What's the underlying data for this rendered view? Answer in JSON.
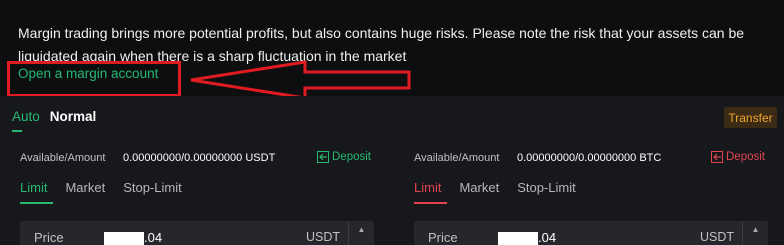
{
  "banner": {
    "message": "Margin trading brings more potential profits, but also contains huge risks. Please note the risk that your assets can be liquidated again when there is a sharp fluctuation in the market",
    "open_account_link": "Open a margin account"
  },
  "colors": {
    "accent_green": "#26b972",
    "accent_red": "#e0454f",
    "annotation_red": "#e01b22",
    "transfer_orange": "#f0a52e"
  },
  "mode_tabs": {
    "auto": "Auto",
    "normal": "Normal"
  },
  "transfer_button": "Transfer",
  "buy_panel": {
    "available_label": "Available/Amount",
    "available_value": "0.00000000/0.00000000 USDT",
    "deposit_label": "Deposit",
    "order_tabs": [
      "Limit",
      "Market",
      "Stop-Limit"
    ],
    "price_label": "Price",
    "price_value": ".04",
    "price_unit": "USDT"
  },
  "sell_panel": {
    "available_label": "Available/Amount",
    "available_value": "0.00000000/0.00000000 BTC",
    "deposit_label": "Deposit",
    "order_tabs": [
      "Limit",
      "Market",
      "Stop-Limit"
    ],
    "price_label": "Price",
    "price_value": ".04",
    "price_unit": "USDT"
  }
}
